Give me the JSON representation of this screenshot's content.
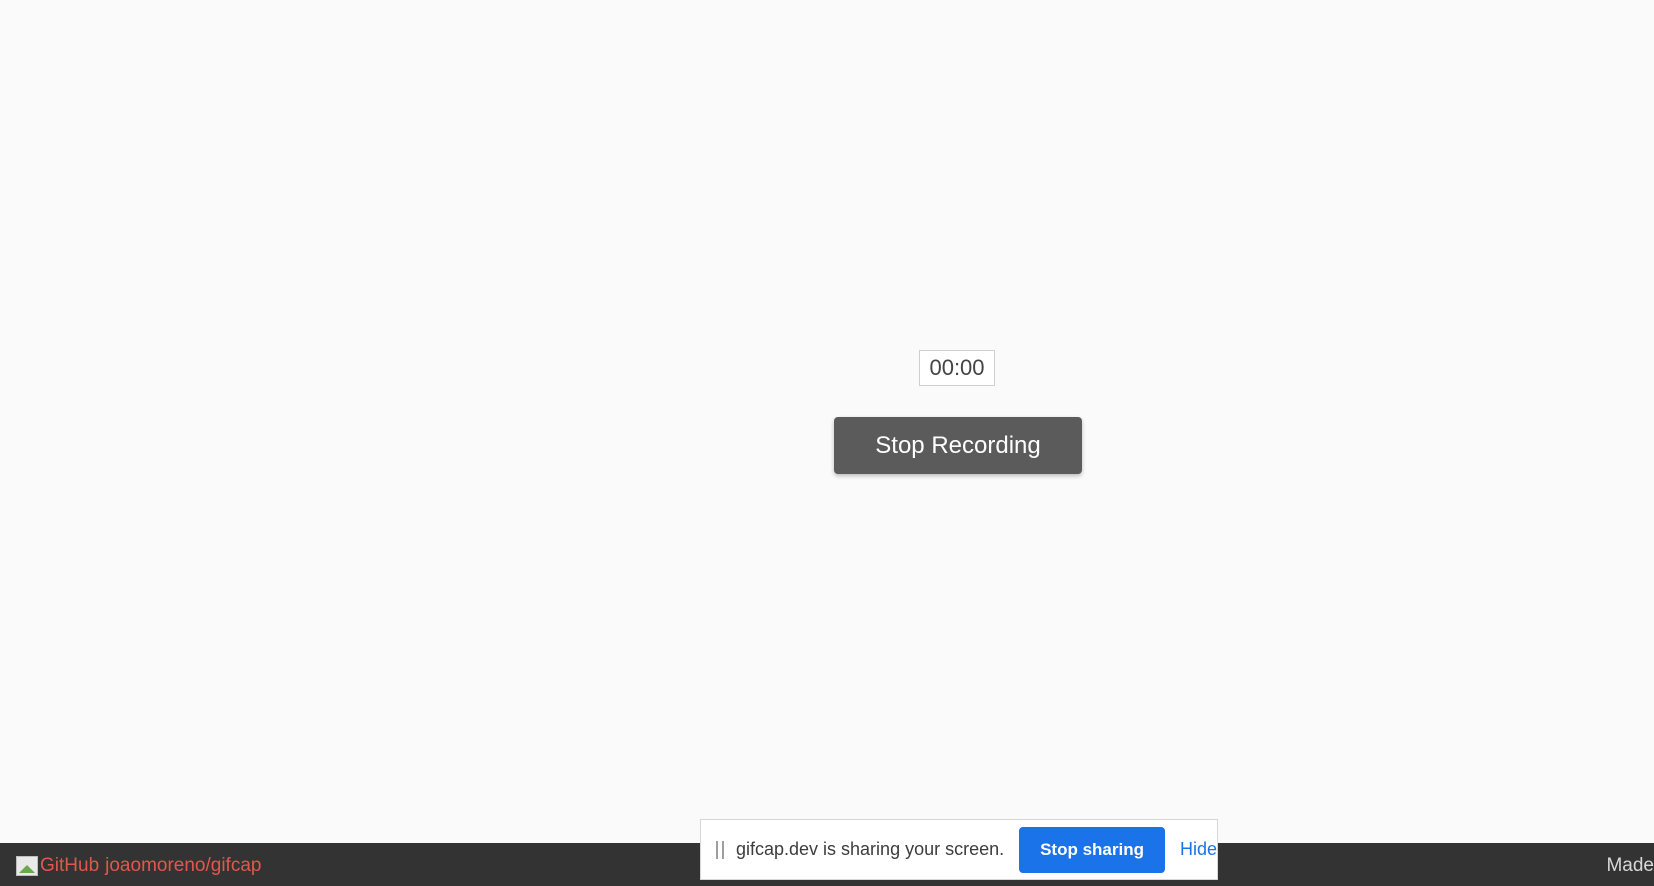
{
  "recorder": {
    "timer": "00:00",
    "stop_label": "Stop Recording"
  },
  "footer": {
    "github_img_alt": "GitHub",
    "repo_link": "joaomoreno/gifcap",
    "made_text": "Made",
    "link_color": "#e2574c",
    "background": "#333333"
  },
  "share_bar": {
    "message": "gifcap.dev is sharing your screen.",
    "stop_sharing_label": "Stop sharing",
    "hide_label": "Hide",
    "accent": "#1a73e8"
  }
}
